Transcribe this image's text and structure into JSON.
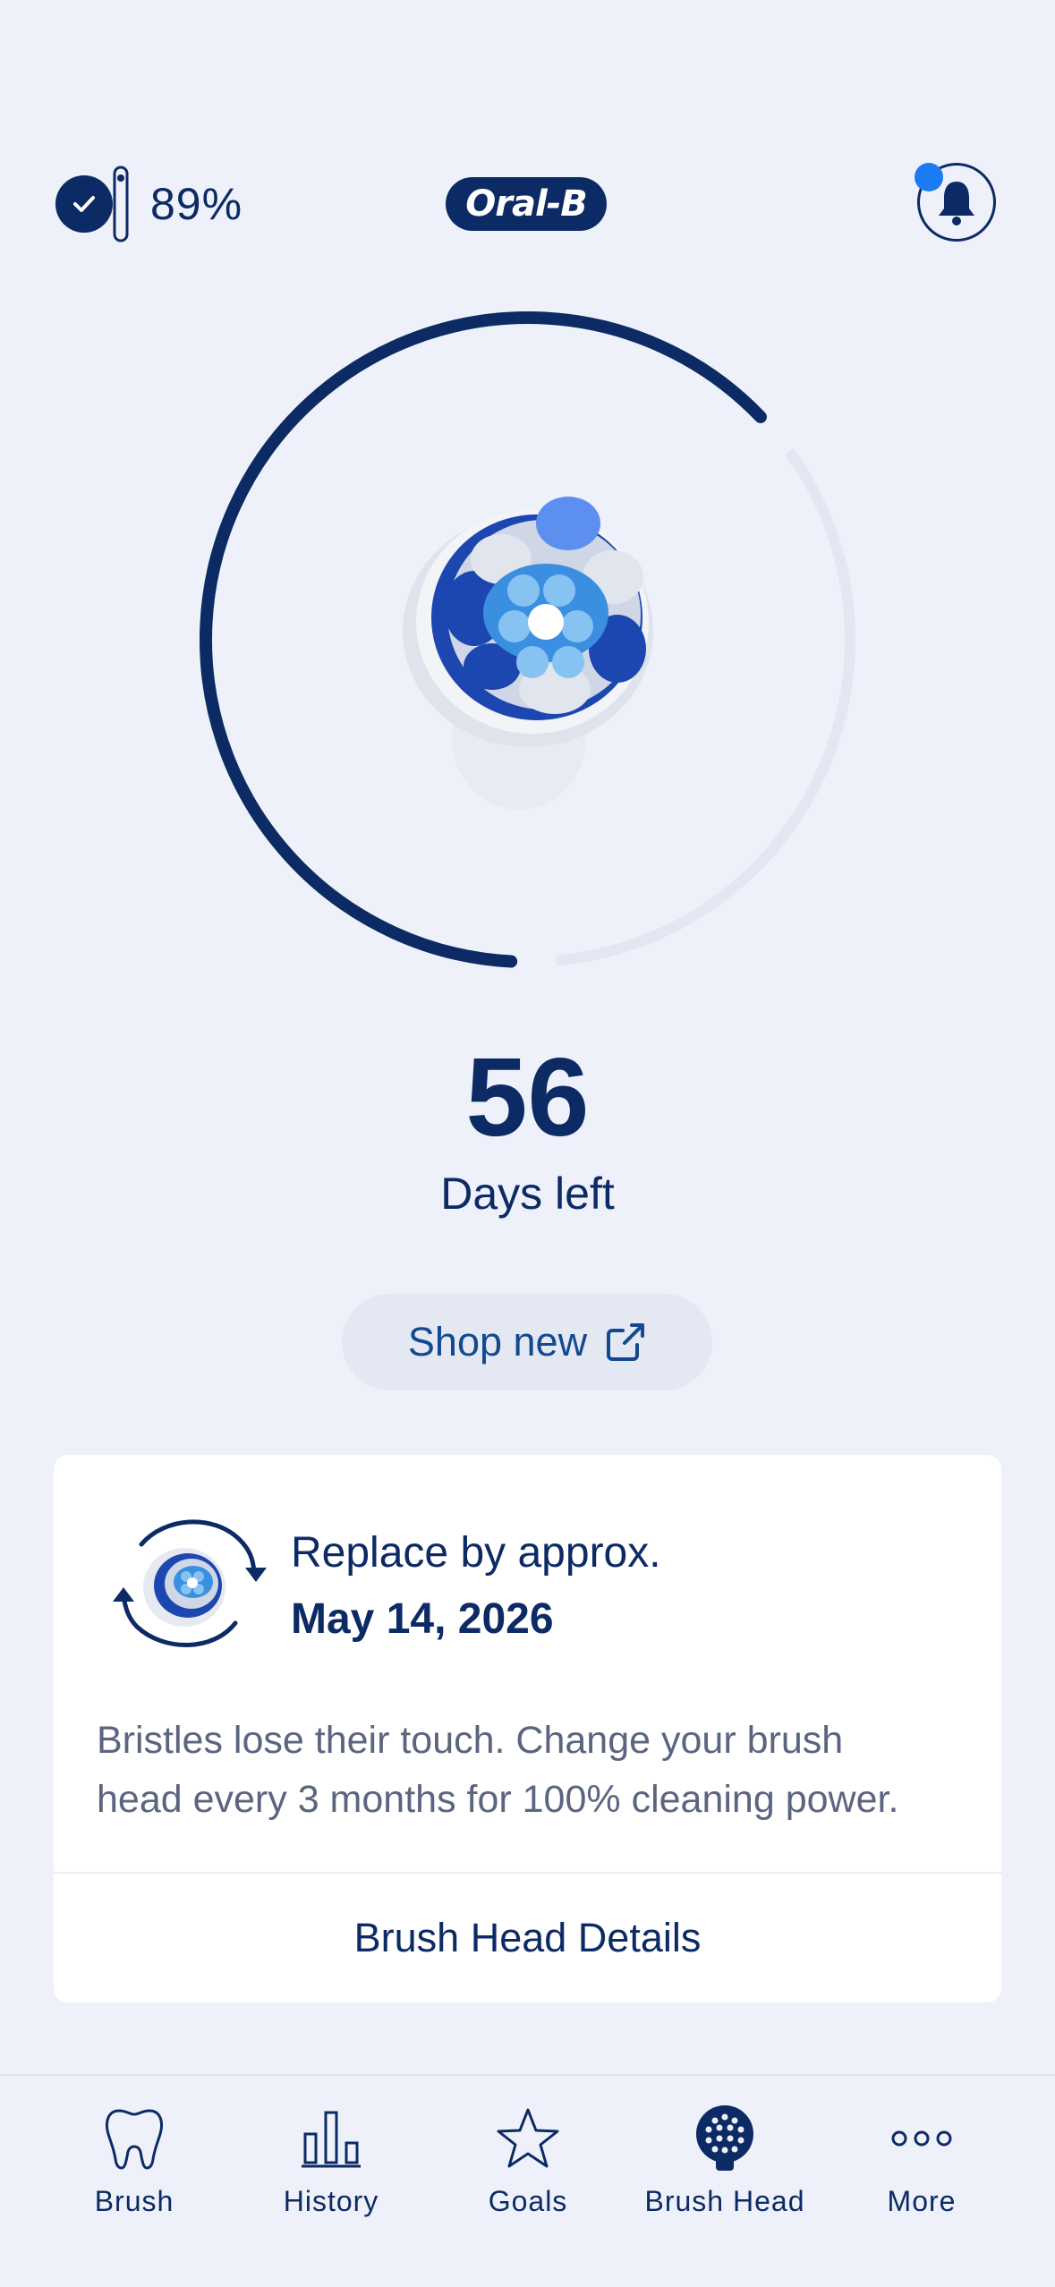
{
  "header": {
    "battery_percent": "89%",
    "brand": "Oral-B",
    "notification_badge": true
  },
  "brush_head": {
    "days_left": "56",
    "days_left_label": "Days left",
    "remaining_fraction": 0.62,
    "shop_label": "Shop new"
  },
  "replace_card": {
    "label": "Replace by approx.",
    "date": "May 14, 2026",
    "description_line1": "Bristles lose their touch. Change your brush",
    "description_line2": "head every 3 months for 100% cleaning power.",
    "details_label": "Brush Head Details"
  },
  "nav": {
    "items": [
      {
        "label": "Brush",
        "icon": "tooth-icon"
      },
      {
        "label": "History",
        "icon": "bar-chart-icon"
      },
      {
        "label": "Goals",
        "icon": "star-icon"
      },
      {
        "label": "Brush Head",
        "icon": "brush-head-icon"
      },
      {
        "label": "More",
        "icon": "more-dots-icon"
      }
    ],
    "active_index": 3
  },
  "colors": {
    "navy": "#0c2a64",
    "accent_blue": "#1a7bf2",
    "background": "#eef1fa"
  }
}
